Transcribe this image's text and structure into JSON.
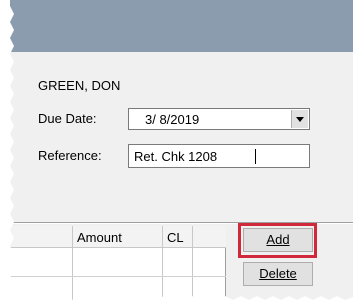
{
  "customer_name": "GREEN, DON",
  "due_date": {
    "label": "Due Date:",
    "value": "3/  8/2019"
  },
  "reference": {
    "label": "Reference:",
    "value": "Ret. Chk 1208"
  },
  "grid": {
    "columns": [
      "Amount",
      "CL"
    ]
  },
  "buttons": {
    "add": "Add",
    "delete": "Delete"
  },
  "colors": {
    "highlight": "#d0293c",
    "titlebar": "#8a9cae"
  }
}
